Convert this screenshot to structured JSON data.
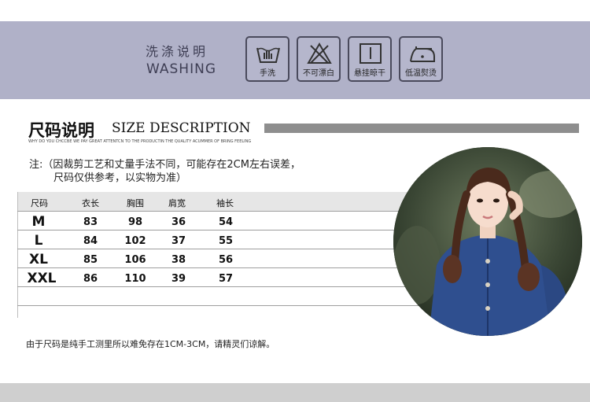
{
  "washing": {
    "title_cn": "洗涤说明",
    "title_en": "WASHING",
    "icons": [
      {
        "icon": "hand-wash-icon",
        "label": "手洗"
      },
      {
        "icon": "no-bleach-icon",
        "label": "不可漂白"
      },
      {
        "icon": "hang-dry-icon",
        "label": "悬挂晾干"
      },
      {
        "icon": "low-iron-icon",
        "label": "低温熨烫"
      }
    ]
  },
  "size": {
    "title_cn": "尺码说明",
    "title_en": "SIZE DESCRIPTION",
    "tagline": "WHY DO YOU CHCCBE WE PAY GREAT ATTENTCN TO THE PRODUCTIN THE QUALITY ACUMMER OF BRING FEELING",
    "note_line1": "注:（因裁剪工艺和丈量手法不同，可能存在2CM左右误差，",
    "note_line2": "尺码仅供参考，以实物为准）",
    "table": {
      "headers": [
        "尺码",
        "衣长",
        "胸围",
        "肩宽",
        "袖长"
      ],
      "rows": [
        [
          "M",
          "83",
          "98",
          "36",
          "54"
        ],
        [
          "L",
          "84",
          "102",
          "37",
          "55"
        ],
        [
          "XL",
          "85",
          "106",
          "38",
          "56"
        ],
        [
          "XXL",
          "86",
          "110",
          "39",
          "57"
        ]
      ]
    },
    "footnote": "由于尺码是纯手工测里所以难免存在1CM-3CM，请精灵们谅解。"
  },
  "colors": {
    "wash_band": "#b0b1c8",
    "title_bar": "#8e8e8e",
    "bottom_band": "#cfcfcf",
    "shirt": "#2f4f8f"
  }
}
